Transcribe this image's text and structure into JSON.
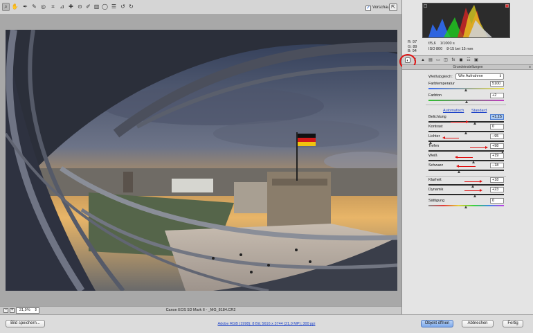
{
  "toolbar": {
    "tools": [
      "zoom-tool",
      "hand-tool",
      "white-balance-tool",
      "color-sampler-tool",
      "target-adjust-tool",
      "crop-tool",
      "straighten-tool",
      "spot-removal-tool",
      "red-eye-tool",
      "adjustment-brush-tool",
      "graduated-filter-tool",
      "radial-filter-tool",
      "preferences-tool",
      "rotate-left-tool",
      "rotate-right-tool"
    ],
    "preview_checked": "✓",
    "preview_label": "Vorschau"
  },
  "statusbar": {
    "zoom_minus": "−",
    "zoom_plus": "+",
    "zoom_value": "21,9%",
    "zoom_arrow": "⇕",
    "filename": "Canon EOS 5D Mark II  -  _MG_8184.CR2"
  },
  "histogram": {
    "r": "R:  97",
    "g": "G:  89",
    "b": "B:  94"
  },
  "camera_info": {
    "aperture": "f/5,6",
    "shutter": "1/1000 s",
    "iso": "ISO 800",
    "focal": "8-15 bei 15 mm"
  },
  "panel": {
    "section_title": "Grundeinstellungen",
    "section_menu": "≡",
    "wb_label": "Weißabgleich:",
    "wb_value": "Wie Aufnahme",
    "wb_arrow": "⇕",
    "link_auto": "Automatisch",
    "link_standard": "Standard",
    "sliders": [
      {
        "label": "Farbtemperatur",
        "value": "5100",
        "pos": 0.5
      },
      {
        "label": "Farbton",
        "value": "+2",
        "pos": 0.51
      },
      {
        "label": "Belichtung",
        "value": "+1,15",
        "pos": 0.62,
        "selected": true
      },
      {
        "label": "Kontrast",
        "value": "0",
        "pos": 0.5
      },
      {
        "label": "Lichter",
        "value": "−95",
        "pos": 0.03
      },
      {
        "label": "Tiefen",
        "value": "+98",
        "pos": 0.99
      },
      {
        "label": "Weiß",
        "value": "+19",
        "pos": 0.6
      },
      {
        "label": "Schwarz",
        "value": "−18",
        "pos": 0.41
      },
      {
        "label": "Klarheit",
        "value": "+18",
        "pos": 0.59
      },
      {
        "label": "Dynamik",
        "value": "+23",
        "pos": 0.62
      },
      {
        "label": "Sättigung",
        "value": "0",
        "pos": 0.5
      }
    ]
  },
  "bottom": {
    "save_label": "Bild speichern...",
    "workflow_label": "Adobe RGB (1998); 8 Bit; 5616 x 3744 (21,0 MP); 300 ppi",
    "open_label": "Objekt öffnen",
    "cancel_label": "Abbrechen",
    "done_label": "Fertig"
  }
}
